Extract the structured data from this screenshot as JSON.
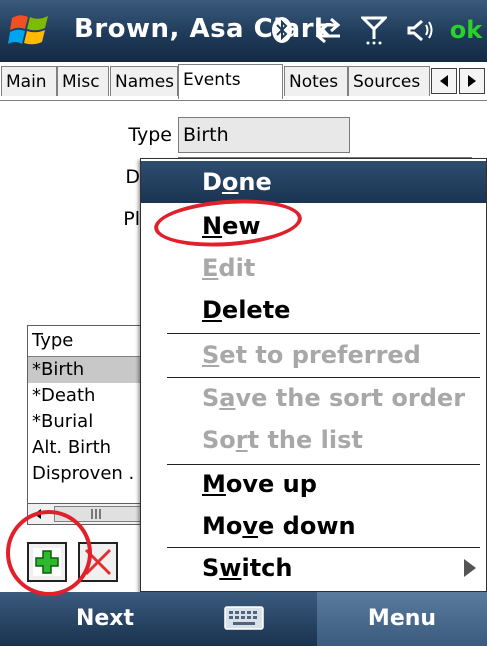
{
  "titlebar": {
    "title": "Brown, Asa Clark",
    "ok_label": "ok",
    "icons": [
      "windows-start-icon",
      "bluetooth-icon",
      "sync-arrows-icon",
      "signal-icon",
      "volume-icon"
    ]
  },
  "tabs": {
    "items": [
      "Main",
      "Misc",
      "Names",
      "Events",
      "Notes",
      "Sources"
    ],
    "active": "Events"
  },
  "form": {
    "type_label": "Type",
    "type_value": "Birth",
    "date_label": "D",
    "place_label": "Pl"
  },
  "list": {
    "header": "Type",
    "rows": [
      "*Birth",
      "*Death",
      "*Burial",
      "Alt. Birth",
      "Disproven ."
    ]
  },
  "menu": {
    "items": [
      {
        "pre": "D",
        "acc": "o",
        "post": "ne",
        "state": "highlighted"
      },
      {
        "pre": "",
        "acc": "N",
        "post": "ew",
        "state": "enabled"
      },
      {
        "pre": "",
        "acc": "E",
        "post": "dit",
        "state": "disabled"
      },
      {
        "pre": "",
        "acc": "D",
        "post": "elete",
        "state": "enabled"
      },
      {
        "pre": "",
        "acc": "S",
        "post": "et to preferred",
        "state": "disabled"
      },
      {
        "pre": "S",
        "acc": "a",
        "post": "ve the sort order",
        "state": "disabled"
      },
      {
        "pre": "So",
        "acc": "r",
        "post": "t the list",
        "state": "disabled"
      },
      {
        "pre": "",
        "acc": "M",
        "post": "ove up",
        "state": "enabled"
      },
      {
        "pre": "Mo",
        "acc": "v",
        "post": "e down",
        "state": "enabled"
      },
      {
        "pre": "S",
        "acc": "w",
        "post": "itch",
        "state": "enabled"
      }
    ]
  },
  "softkeys": {
    "left": "Next",
    "right": "Menu"
  },
  "colors": {
    "accent_dark": "#1f3b5a",
    "ok_green": "#2ad12a",
    "disabled_text": "#a8a8a8",
    "annotation_red": "#e0202a"
  }
}
